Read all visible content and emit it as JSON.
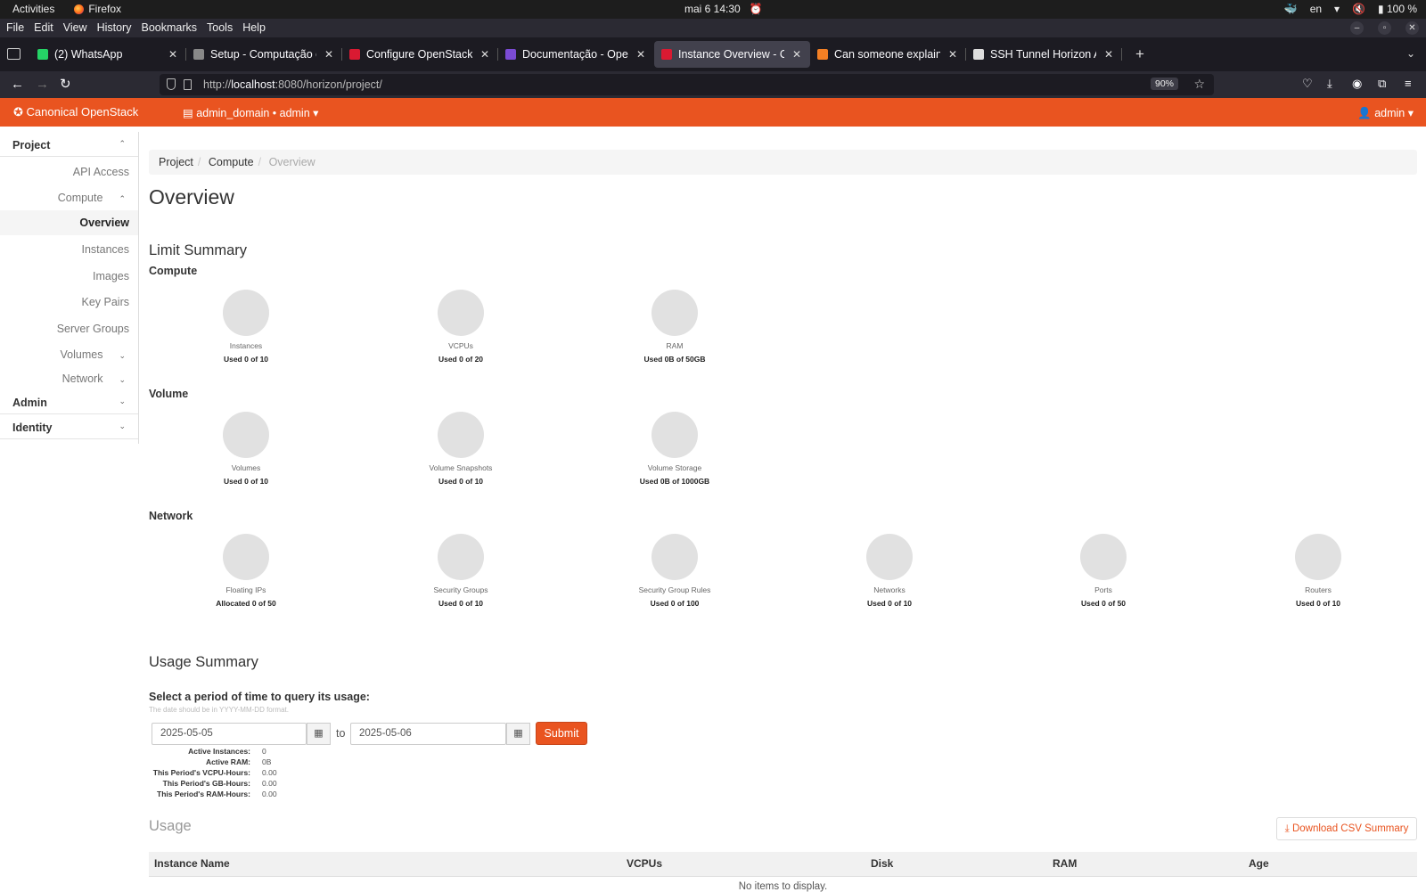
{
  "os_bar": {
    "activities": "Activities",
    "app": "Firefox",
    "datetime": "mai 6  14:30",
    "lang": "en",
    "battery": "100 %"
  },
  "menu": [
    "File",
    "Edit",
    "View",
    "History",
    "Bookmarks",
    "Tools",
    "Help"
  ],
  "tabs": [
    {
      "title": "(2) WhatsApp",
      "color": "#25d366"
    },
    {
      "title": "Setup - Computação em Nuvem",
      "color": "#888888"
    },
    {
      "title": "Configure OpenStack — c",
      "color": "#da1a32"
    },
    {
      "title": "Documentação - OpenStack",
      "color": "#7b4bd4"
    },
    {
      "title": "Instance Overview - OpenStack",
      "color": "#da1a32"
    },
    {
      "title": "Can someone explain SSH",
      "color": "#f48024"
    },
    {
      "title": "SSH Tunnel Horizon Access",
      "color": "#dddddd"
    }
  ],
  "active_tab": 4,
  "new_tab": "+",
  "address": {
    "prefix": "http://",
    "host": "localhost",
    "rest": ":8080/horizon/project/",
    "zoom": "90%"
  },
  "header": {
    "brand": "Canonical OpenStack",
    "project": "admin_domain • admin",
    "user": "admin",
    "color": "#e95420"
  },
  "sidebar": {
    "project": "Project",
    "api_access": "API Access",
    "compute": "Compute",
    "overview": "Overview",
    "instances": "Instances",
    "images": "Images",
    "key_pairs": "Key Pairs",
    "server_groups": "Server Groups",
    "volumes": "Volumes",
    "network": "Network",
    "admin": "Admin",
    "identity": "Identity"
  },
  "breadcrumb": [
    "Project",
    "Compute",
    "Overview"
  ],
  "page_title": "Overview",
  "limit_summary": {
    "title": "Limit Summary",
    "compute": {
      "title": "Compute",
      "items": [
        {
          "label": "Instances",
          "used": "Used 0 of 10"
        },
        {
          "label": "VCPUs",
          "used": "Used 0 of 20"
        },
        {
          "label": "RAM",
          "used": "Used 0B of 50GB"
        }
      ]
    },
    "volume": {
      "title": "Volume",
      "items": [
        {
          "label": "Volumes",
          "used": "Used 0 of 10"
        },
        {
          "label": "Volume Snapshots",
          "used": "Used 0 of 10"
        },
        {
          "label": "Volume Storage",
          "used": "Used 0B of 1000GB"
        }
      ]
    },
    "network": {
      "title": "Network",
      "items": [
        {
          "label": "Floating IPs",
          "used": "Allocated 0 of 50"
        },
        {
          "label": "Security Groups",
          "used": "Used 0 of 10"
        },
        {
          "label": "Security Group Rules",
          "used": "Used 0 of 100"
        },
        {
          "label": "Networks",
          "used": "Used 0 of 10"
        },
        {
          "label": "Ports",
          "used": "Used 0 of 50"
        },
        {
          "label": "Routers",
          "used": "Used 0 of 10"
        }
      ]
    }
  },
  "usage_summary": {
    "title": "Usage Summary",
    "question": "Select a period of time to query its usage:",
    "hint": "The date should be in YYYY-MM-DD format.",
    "start": "2025-05-05",
    "to": "to",
    "end": "2025-05-06",
    "submit": "Submit",
    "stats": [
      {
        "k": "Active Instances:",
        "v": "0"
      },
      {
        "k": "Active RAM:",
        "v": "0B"
      },
      {
        "k": "This Period's VCPU-Hours:",
        "v": "0.00"
      },
      {
        "k": "This Period's GB-Hours:",
        "v": "0.00"
      },
      {
        "k": "This Period's RAM-Hours:",
        "v": "0.00"
      }
    ]
  },
  "usage": {
    "title": "Usage",
    "csv": "Download CSV Summary",
    "columns": [
      "Instance Name",
      "VCPUs",
      "Disk",
      "RAM",
      "Age"
    ],
    "empty": "No items to display."
  }
}
